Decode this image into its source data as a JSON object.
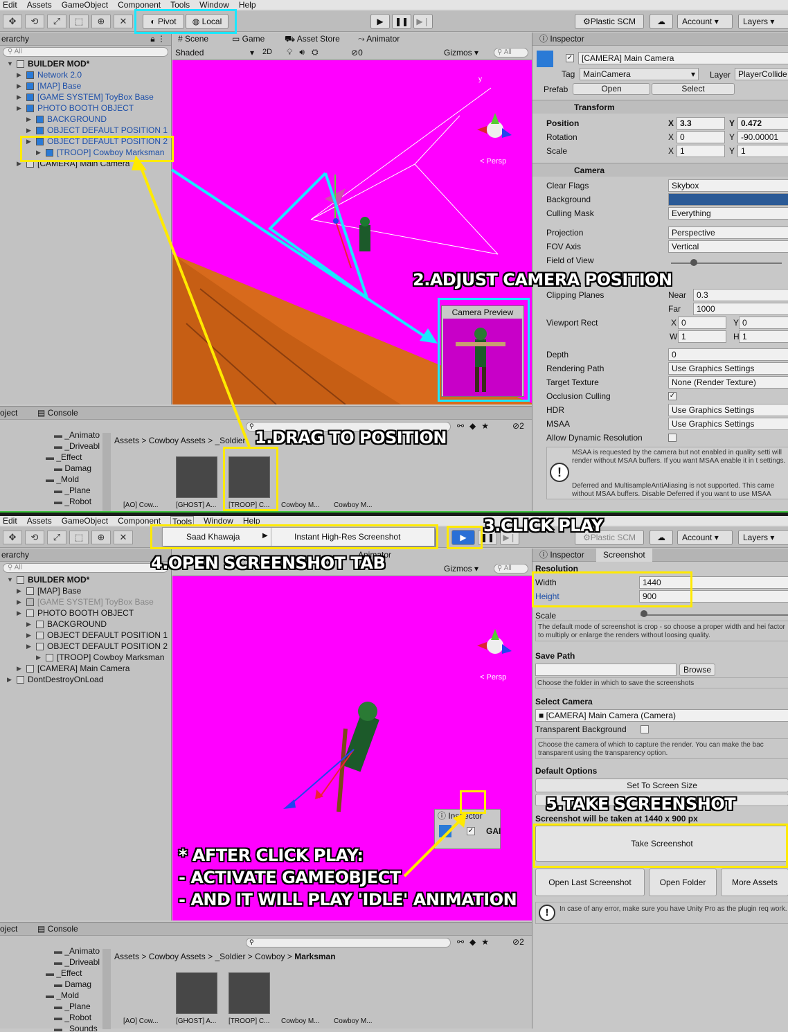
{
  "menu_top": [
    "Edit",
    "Assets",
    "GameObject",
    "Component",
    "Tools",
    "Window",
    "Help"
  ],
  "menu_bottom": [
    "Edit",
    "Assets",
    "GameObject",
    "Component",
    "Tools",
    "Window",
    "Help"
  ],
  "toolbar": {
    "pivot": "Pivot",
    "local": "Local",
    "plastic": "Plastic SCM",
    "account": "Account",
    "layers": "Layers"
  },
  "tools_menu": {
    "item": "Saad Khawaja",
    "submenu_item": "Instant High-Res Screenshot"
  },
  "hierarchy_top": {
    "tab": "erarchy",
    "search": "All",
    "items": [
      {
        "label": "BUILDER MOD*",
        "style": "root"
      },
      {
        "label": "Network 2.0",
        "style": "blue"
      },
      {
        "label": "[MAP] Base",
        "style": "blue"
      },
      {
        "label": "[GAME SYSTEM] ToyBox Base",
        "style": "blue"
      },
      {
        "label": "PHOTO BOOTH OBJECT",
        "style": "blue"
      },
      {
        "label": "BACKGROUND",
        "style": "blue"
      },
      {
        "label": "OBJECT DEFAULT POSITION 1",
        "style": "blue"
      },
      {
        "label": "OBJECT DEFAULT POSITION 2",
        "style": "blue"
      },
      {
        "label": "[TROOP] Cowboy Marksman",
        "style": "blue"
      },
      {
        "label": "[CAMERA] Main Camera",
        "style": "normal"
      }
    ]
  },
  "hierarchy_bottom": {
    "tab": "erarchy",
    "search": "All",
    "items": [
      {
        "label": "BUILDER MOD*",
        "style": "root"
      },
      {
        "label": "[MAP] Base",
        "style": "normal"
      },
      {
        "label": "[GAME SYSTEM] ToyBox Base",
        "style": "gray"
      },
      {
        "label": "PHOTO BOOTH OBJECT",
        "style": "normal"
      },
      {
        "label": "BACKGROUND",
        "style": "normal"
      },
      {
        "label": "OBJECT DEFAULT POSITION 1",
        "style": "normal"
      },
      {
        "label": "OBJECT DEFAULT POSITION 2",
        "style": "normal"
      },
      {
        "label": "[TROOP] Cowboy Marksman",
        "style": "normal"
      },
      {
        "label": "[CAMERA] Main Camera",
        "style": "normal"
      },
      {
        "label": "DontDestroyOnLoad",
        "style": "normal"
      }
    ]
  },
  "scene": {
    "tabs": [
      "Scene",
      "Game",
      "Asset Store",
      "Animator"
    ],
    "shading": "Shaded",
    "mode_2d": "2D",
    "layer_count": "0",
    "gizmos": "Gizmos",
    "search": "All",
    "persp": "< Persp",
    "camera_preview_title": "Camera Preview"
  },
  "inspector": {
    "tab": "Inspector",
    "object_name": "[CAMERA] Main Camera",
    "tag_label": "Tag",
    "tag": "MainCamera",
    "layer_label": "Layer",
    "layer": "PlayerCollide",
    "prefab_label": "Prefab",
    "open": "Open",
    "select": "Select",
    "transform": "Transform",
    "position_label": "Position",
    "pos_x": "3.3",
    "pos_y": "0.472",
    "rotation_label": "Rotation",
    "rot_x": "0",
    "rot_y": "-90.00001",
    "scale_label": "Scale",
    "scale_x": "1",
    "scale_y": "1",
    "camera": "Camera",
    "rows": [
      {
        "label": "Clear Flags",
        "value": "Skybox"
      },
      {
        "label": "Background",
        "value": ""
      },
      {
        "label": "Culling Mask",
        "value": "Everything"
      },
      {
        "label": "Projection",
        "value": "Perspective"
      },
      {
        "label": "FOV Axis",
        "value": "Vertical"
      },
      {
        "label": "Field of View",
        "value": ""
      }
    ],
    "clipping_label": "Clipping Planes",
    "near_label": "Near",
    "near": "0.3",
    "far_label": "Far",
    "far": "1000",
    "viewport_label": "Viewport Rect",
    "vp_x": "0",
    "vp_y": "0",
    "vp_w": "1",
    "vp_h": "1",
    "rows2": [
      {
        "label": "Depth",
        "value": "0"
      },
      {
        "label": "Rendering Path",
        "value": "Use Graphics Settings"
      },
      {
        "label": "Target Texture",
        "value": "None (Render Texture)"
      },
      {
        "label": "Occlusion Culling",
        "value": "✓"
      },
      {
        "label": "HDR",
        "value": "Use Graphics Settings"
      },
      {
        "label": "MSAA",
        "value": "Use Graphics Settings"
      },
      {
        "label": "Allow Dynamic Resolution",
        "value": ""
      }
    ],
    "warning1": "MSAA is requested by the camera but not enabled in quality setti will render without MSAA buffers. If you want MSAA enable it in t settings.",
    "warning2": "Deferred and MultisampleAntiAliasing is not supported. This came without MSAA buffers. Disable Deferred if you want to use MSAA"
  },
  "screenshot_tab": {
    "tabs": [
      "Inspector",
      "Screenshot"
    ],
    "resolution": "Resolution",
    "width_label": "Width",
    "width": "1440",
    "height_label": "Height",
    "height": "900",
    "scale_label": "Scale",
    "scale_note": "The default mode of screenshot is crop - so choose a proper width and hei factor to multiply or enlarge the renders without loosing quality.",
    "save_path": "Save Path",
    "browse": "Browse",
    "save_note": "Choose the folder in which to save the screenshots",
    "select_camera": "Select Camera",
    "camera_value": "[CAMERA] Main Camera (Camera)",
    "transparent": "Transparent Background",
    "camera_note": "Choose the camera of which to capture the render. You can make the bac transparent using the transparency option.",
    "default_options": "Default Options",
    "set_screen": "Set To Screen Size",
    "will_be": "Screenshot will be taken at 1440 x 900 px",
    "take": "Take Screenshot",
    "open_last": "Open Last Screenshot",
    "open_folder": "Open Folder",
    "more_assets": "More Assets",
    "error_note": "In case of any error, make sure you have Unity Pro as the plugin req work."
  },
  "project_top": {
    "tab_left": "oject",
    "console": "Console",
    "count": "2",
    "folders": [
      "_Animato",
      "_Driveabl",
      "_Effect",
      "Damag",
      "_Mold",
      "_Plane",
      "_Robot"
    ],
    "breadcrumb": [
      "Assets",
      "Cowboy Assets",
      "_Soldier"
    ],
    "assets": [
      "[AO] Cow...",
      "[GHOST] A...",
      "[TROOP] C...",
      "Cowboy M...",
      "Cowboy M..."
    ]
  },
  "project_bottom": {
    "tab_left": "oject",
    "console": "Console",
    "count": "2",
    "folders": [
      "_Animato",
      "_Driveabl",
      "_Effect",
      "Damag",
      "_Mold",
      "_Plane",
      "_Robot",
      "_Sounds"
    ],
    "breadcrumb": [
      "Assets",
      "Cowboy Assets",
      "_Soldier",
      "Cowboy",
      "Marksman"
    ],
    "assets": [
      "[AO] Cow...",
      "[GHOST] A...",
      "[TROOP] C...",
      "Cowboy M...",
      "Cowboy M..."
    ]
  },
  "mini_inspector": {
    "title": "Inspector",
    "text": "GAI"
  },
  "callouts": {
    "c1": "1.DRAG TO POSITION",
    "c2": "2.ADJUST CAMERA POSITION",
    "c3": "3.CLICK PLAY",
    "c4": "4.OPEN SCREENSHOT TAB",
    "c5": "5.TAKE SCREENSHOT",
    "after1": "* AFTER CLICK PLAY:",
    "after2": "- ACTIVATE GAMEOBJECT",
    "after3": "- AND IT WILL PLAY 'IDLE' ANIMATION"
  },
  "colors": {
    "magenta": "#ff00ff",
    "callout_yellow": "#ffea00",
    "callout_cyan": "#1be7ff",
    "play_blue": "#2a6fd6",
    "bg_blue": "#2b5a96"
  }
}
